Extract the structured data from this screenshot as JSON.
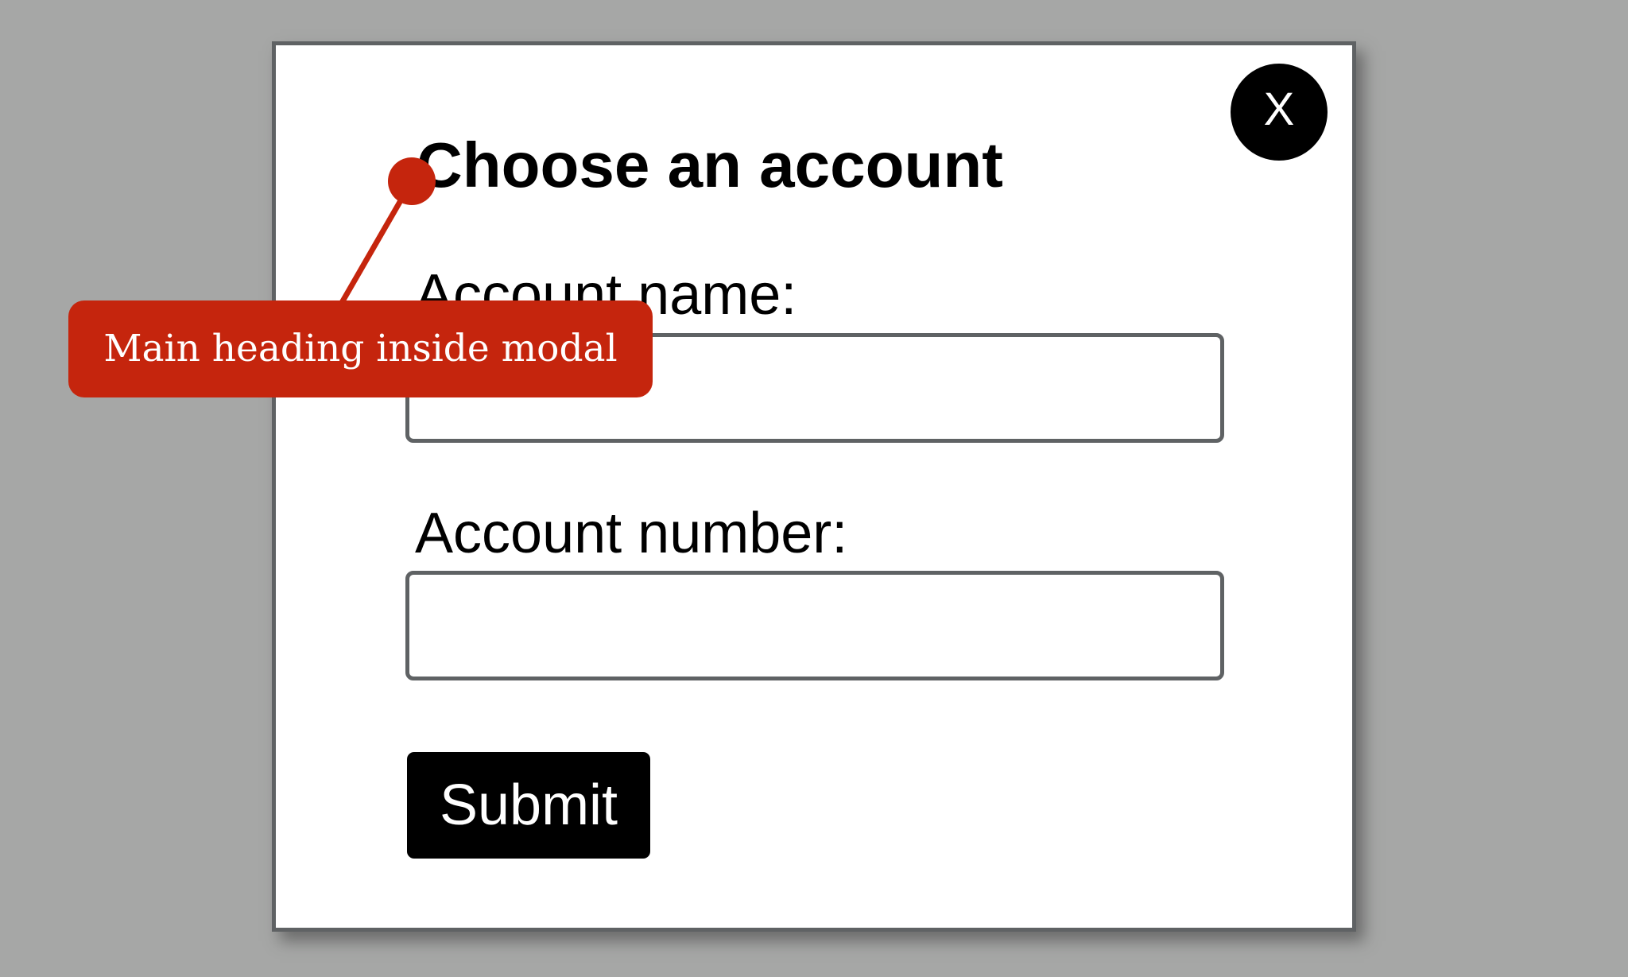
{
  "modal": {
    "title": "Choose an account",
    "close_label": "X",
    "fields": [
      {
        "label": "Account name:",
        "value": "",
        "placeholder": ""
      },
      {
        "label": "Account number:",
        "value": "",
        "placeholder": ""
      }
    ],
    "submit_label": "Submit"
  },
  "annotation": {
    "text": "Main heading inside modal",
    "target": "modal-title"
  },
  "colors": {
    "backdrop": "#a6a7a6",
    "modal_border": "#5f6264",
    "annotation": "#c5250d",
    "button": "#000000"
  }
}
